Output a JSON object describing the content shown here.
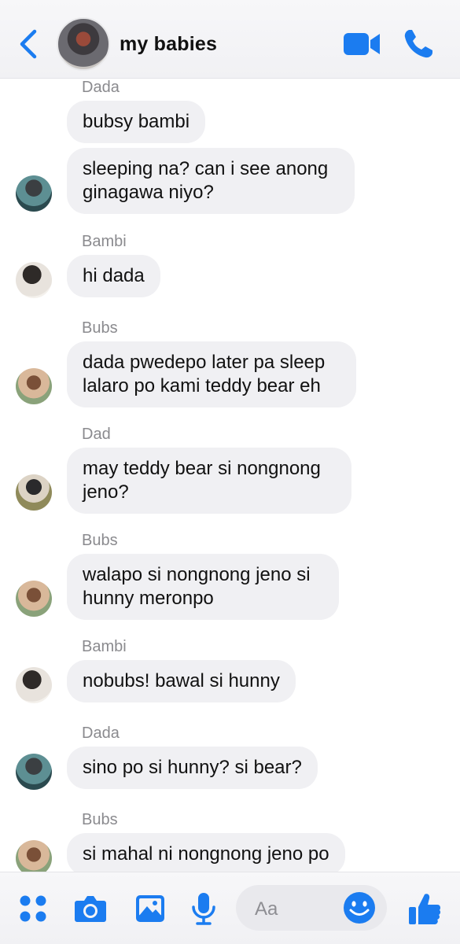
{
  "header": {
    "title": "my babies"
  },
  "messages": [
    {
      "sender": "Dada",
      "texts": [
        "bubsy bambi",
        "sleeping na? can i see anong\nginagawa niyo?"
      ]
    },
    {
      "sender": "Bambi",
      "texts": [
        "hi dada"
      ]
    },
    {
      "sender": "Bubs",
      "texts": [
        "dada pwedepo later pa sleep\nlalaro po kami teddy bear eh"
      ]
    },
    {
      "sender": "Dad",
      "texts": [
        "may teddy bear si nongnong\njeno?"
      ]
    },
    {
      "sender": "Bubs",
      "texts": [
        "walapo si nongnong jeno si\nhunny meronpo"
      ]
    },
    {
      "sender": "Bambi",
      "texts": [
        "nobubs! bawal si hunny"
      ]
    },
    {
      "sender": "Dada",
      "texts": [
        "sino po si hunny? si bear?"
      ]
    },
    {
      "sender": "Bubs",
      "texts": [
        "si mahal ni nongnong jeno po"
      ]
    }
  ],
  "composer": {
    "placeholder": "Aa"
  },
  "icons": [
    "back-arrow-icon",
    "video-camera-icon",
    "phone-icon",
    "apps-grid-icon",
    "camera-icon",
    "photo-icon",
    "microphone-icon",
    "emoji-icon",
    "thumbs-up-icon"
  ],
  "colors": {
    "accent": "#1b7cf0",
    "bubble": "#f0f0f3",
    "sender_label": "#8a8a8e"
  }
}
